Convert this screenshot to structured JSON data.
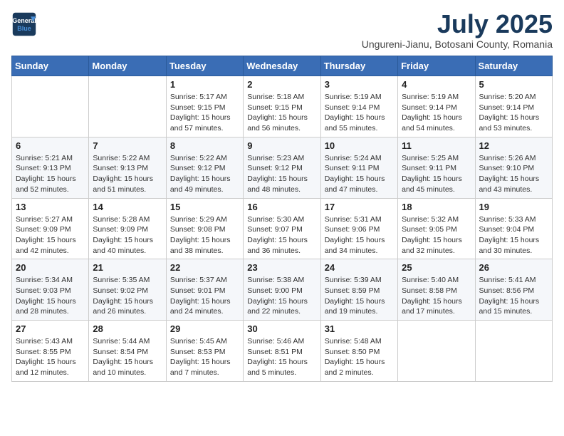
{
  "header": {
    "logo_line1": "General",
    "logo_line2": "Blue",
    "month_title": "July 2025",
    "subtitle": "Ungureni-Jianu, Botosani County, Romania"
  },
  "days_of_week": [
    "Sunday",
    "Monday",
    "Tuesday",
    "Wednesday",
    "Thursday",
    "Friday",
    "Saturday"
  ],
  "weeks": [
    [
      {
        "day": "",
        "info": ""
      },
      {
        "day": "",
        "info": ""
      },
      {
        "day": "1",
        "info": "Sunrise: 5:17 AM\nSunset: 9:15 PM\nDaylight: 15 hours and 57 minutes."
      },
      {
        "day": "2",
        "info": "Sunrise: 5:18 AM\nSunset: 9:15 PM\nDaylight: 15 hours and 56 minutes."
      },
      {
        "day": "3",
        "info": "Sunrise: 5:19 AM\nSunset: 9:14 PM\nDaylight: 15 hours and 55 minutes."
      },
      {
        "day": "4",
        "info": "Sunrise: 5:19 AM\nSunset: 9:14 PM\nDaylight: 15 hours and 54 minutes."
      },
      {
        "day": "5",
        "info": "Sunrise: 5:20 AM\nSunset: 9:14 PM\nDaylight: 15 hours and 53 minutes."
      }
    ],
    [
      {
        "day": "6",
        "info": "Sunrise: 5:21 AM\nSunset: 9:13 PM\nDaylight: 15 hours and 52 minutes."
      },
      {
        "day": "7",
        "info": "Sunrise: 5:22 AM\nSunset: 9:13 PM\nDaylight: 15 hours and 51 minutes."
      },
      {
        "day": "8",
        "info": "Sunrise: 5:22 AM\nSunset: 9:12 PM\nDaylight: 15 hours and 49 minutes."
      },
      {
        "day": "9",
        "info": "Sunrise: 5:23 AM\nSunset: 9:12 PM\nDaylight: 15 hours and 48 minutes."
      },
      {
        "day": "10",
        "info": "Sunrise: 5:24 AM\nSunset: 9:11 PM\nDaylight: 15 hours and 47 minutes."
      },
      {
        "day": "11",
        "info": "Sunrise: 5:25 AM\nSunset: 9:11 PM\nDaylight: 15 hours and 45 minutes."
      },
      {
        "day": "12",
        "info": "Sunrise: 5:26 AM\nSunset: 9:10 PM\nDaylight: 15 hours and 43 minutes."
      }
    ],
    [
      {
        "day": "13",
        "info": "Sunrise: 5:27 AM\nSunset: 9:09 PM\nDaylight: 15 hours and 42 minutes."
      },
      {
        "day": "14",
        "info": "Sunrise: 5:28 AM\nSunset: 9:09 PM\nDaylight: 15 hours and 40 minutes."
      },
      {
        "day": "15",
        "info": "Sunrise: 5:29 AM\nSunset: 9:08 PM\nDaylight: 15 hours and 38 minutes."
      },
      {
        "day": "16",
        "info": "Sunrise: 5:30 AM\nSunset: 9:07 PM\nDaylight: 15 hours and 36 minutes."
      },
      {
        "day": "17",
        "info": "Sunrise: 5:31 AM\nSunset: 9:06 PM\nDaylight: 15 hours and 34 minutes."
      },
      {
        "day": "18",
        "info": "Sunrise: 5:32 AM\nSunset: 9:05 PM\nDaylight: 15 hours and 32 minutes."
      },
      {
        "day": "19",
        "info": "Sunrise: 5:33 AM\nSunset: 9:04 PM\nDaylight: 15 hours and 30 minutes."
      }
    ],
    [
      {
        "day": "20",
        "info": "Sunrise: 5:34 AM\nSunset: 9:03 PM\nDaylight: 15 hours and 28 minutes."
      },
      {
        "day": "21",
        "info": "Sunrise: 5:35 AM\nSunset: 9:02 PM\nDaylight: 15 hours and 26 minutes."
      },
      {
        "day": "22",
        "info": "Sunrise: 5:37 AM\nSunset: 9:01 PM\nDaylight: 15 hours and 24 minutes."
      },
      {
        "day": "23",
        "info": "Sunrise: 5:38 AM\nSunset: 9:00 PM\nDaylight: 15 hours and 22 minutes."
      },
      {
        "day": "24",
        "info": "Sunrise: 5:39 AM\nSunset: 8:59 PM\nDaylight: 15 hours and 19 minutes."
      },
      {
        "day": "25",
        "info": "Sunrise: 5:40 AM\nSunset: 8:58 PM\nDaylight: 15 hours and 17 minutes."
      },
      {
        "day": "26",
        "info": "Sunrise: 5:41 AM\nSunset: 8:56 PM\nDaylight: 15 hours and 15 minutes."
      }
    ],
    [
      {
        "day": "27",
        "info": "Sunrise: 5:43 AM\nSunset: 8:55 PM\nDaylight: 15 hours and 12 minutes."
      },
      {
        "day": "28",
        "info": "Sunrise: 5:44 AM\nSunset: 8:54 PM\nDaylight: 15 hours and 10 minutes."
      },
      {
        "day": "29",
        "info": "Sunrise: 5:45 AM\nSunset: 8:53 PM\nDaylight: 15 hours and 7 minutes."
      },
      {
        "day": "30",
        "info": "Sunrise: 5:46 AM\nSunset: 8:51 PM\nDaylight: 15 hours and 5 minutes."
      },
      {
        "day": "31",
        "info": "Sunrise: 5:48 AM\nSunset: 8:50 PM\nDaylight: 15 hours and 2 minutes."
      },
      {
        "day": "",
        "info": ""
      },
      {
        "day": "",
        "info": ""
      }
    ]
  ]
}
